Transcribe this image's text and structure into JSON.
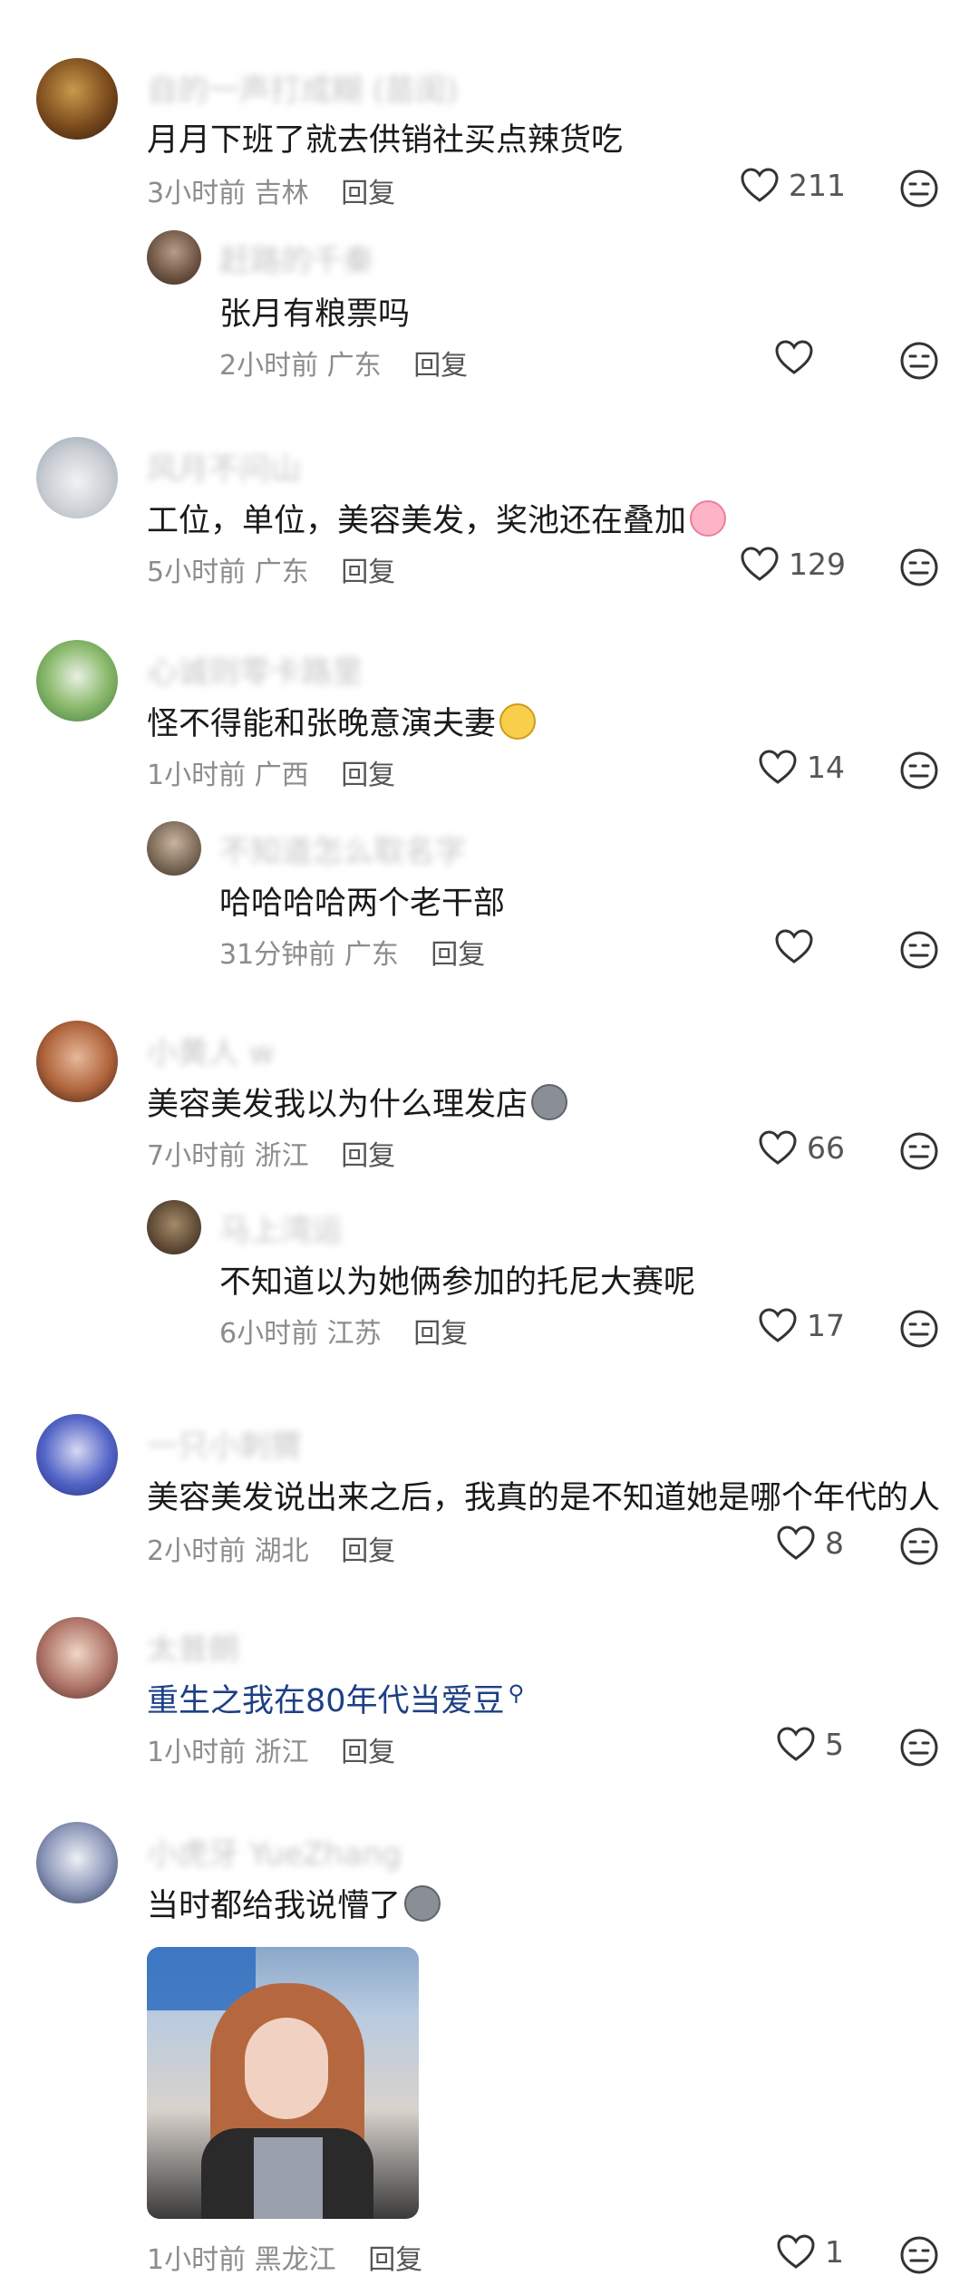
{
  "comments": [
    {
      "username": "(blurred)",
      "text": "月月下班了就去供销社买点辣货吃",
      "time": "3小时前",
      "location": "吉林",
      "reply_label": "回复",
      "likes": "211"
    },
    {
      "username": "(blurred)",
      "text": "张月有粮票吗",
      "time": "2小时前",
      "location": "广东",
      "reply_label": "回复",
      "likes": ""
    },
    {
      "username": "(blurred)",
      "text": "工位，单位，美容美发，奖池还在叠加",
      "emoji": "pig-emoji",
      "time": "5小时前",
      "location": "广东",
      "reply_label": "回复",
      "likes": "129"
    },
    {
      "username": "(blurred)",
      "text": "怪不得能和张晚意演夫妻",
      "emoji": "doge-emoji",
      "time": "1小时前",
      "location": "广西",
      "reply_label": "回复",
      "likes": "14"
    },
    {
      "username": "(blurred)",
      "text": "哈哈哈哈两个老干部",
      "time": "31分钟前",
      "location": "广东",
      "reply_label": "回复",
      "likes": ""
    },
    {
      "username": "(blurred)",
      "text": "美容美发我以为什么理发店",
      "emoji": "speechless-emoji",
      "time": "7小时前",
      "location": "浙江",
      "reply_label": "回复",
      "likes": "66"
    },
    {
      "username": "(blurred)",
      "text": "不知道以为她俩参加的托尼大赛呢",
      "time": "6小时前",
      "location": "江苏",
      "reply_label": "回复",
      "likes": "17"
    },
    {
      "username": "(blurred)",
      "text": "美容美发说出来之后，我真的是不知道她是哪个年代的人",
      "time": "2小时前",
      "location": "湖北",
      "reply_label": "回复",
      "likes": "8"
    },
    {
      "username": "(blurred)",
      "text": "重生之我在80年代当爱豆",
      "search_icon": "search-icon",
      "time": "1小时前",
      "location": "浙江",
      "reply_label": "回复",
      "likes": "5"
    },
    {
      "username": "(blurred)",
      "text": "当时都给我说懵了",
      "emoji": "speechless-emoji",
      "time": "1小时前",
      "location": "黑龙江",
      "reply_label": "回复",
      "likes": "1"
    }
  ],
  "icons": {
    "like": "heart-icon",
    "react": "emoji-face-icon"
  },
  "colors": {
    "meta": "#8c8c8c",
    "link": "#1d3f84",
    "username": "#c6c6c6"
  }
}
